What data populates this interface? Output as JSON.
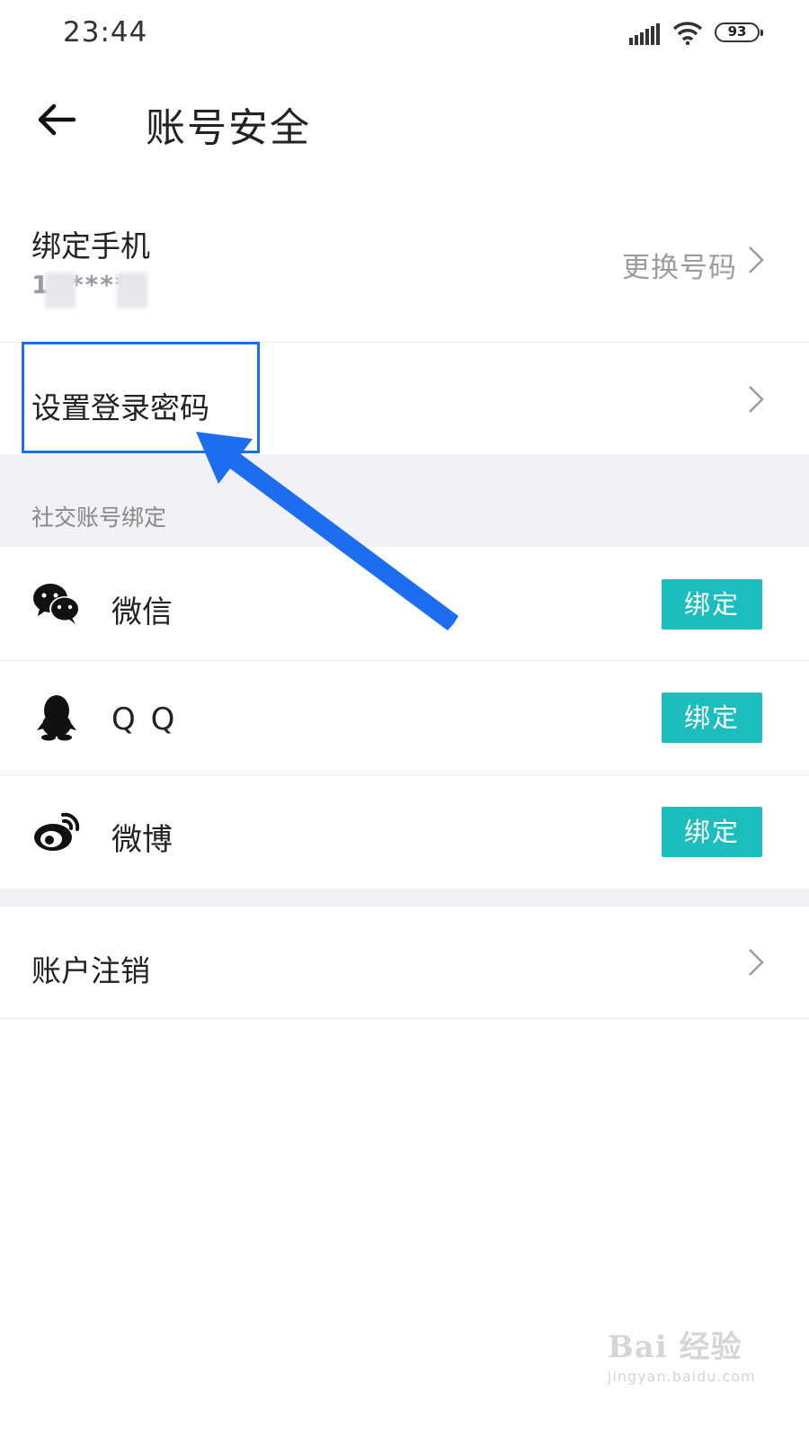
{
  "status_bar": {
    "time": "23:44",
    "battery": "93"
  },
  "header": {
    "title": "账号安全"
  },
  "phone": {
    "label": "绑定手机",
    "number_masked": "15*****",
    "change_label": "更换号码"
  },
  "password": {
    "label": "设置登录密码"
  },
  "social": {
    "section_title": "社交账号绑定",
    "items": [
      {
        "name": "微信",
        "icon": "wechat-icon",
        "button": "绑定"
      },
      {
        "name": "Q Q",
        "icon": "qq-icon",
        "button": "绑定"
      },
      {
        "name": "微博",
        "icon": "weibo-icon",
        "button": "绑定"
      }
    ]
  },
  "account": {
    "cancel_label": "账户注销"
  },
  "watermark": {
    "main": "Bai 经验",
    "sub": "jingyan.baidu.com"
  },
  "colors": {
    "accent": "#1bbdbd",
    "annotation": "#1d6df0"
  }
}
